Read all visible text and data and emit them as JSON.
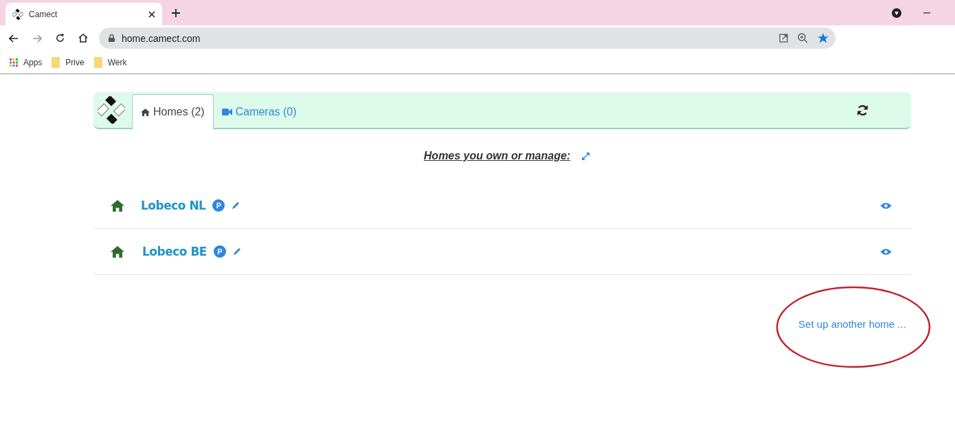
{
  "browser": {
    "tab_title": "Camect",
    "url": "home.camect.com",
    "bookmarks": [
      {
        "label": "Apps",
        "kind": "apps"
      },
      {
        "label": "Prive",
        "kind": "folder"
      },
      {
        "label": "Werk",
        "kind": "folder"
      }
    ]
  },
  "tabs": [
    {
      "label": "Homes (2)",
      "kind": "home",
      "selected": true
    },
    {
      "label": "Cameras (0)",
      "kind": "camera",
      "selected": false
    }
  ],
  "heading": "Homes you own or manage:",
  "homes": [
    {
      "name": "Lobeco NL",
      "badge": "P"
    },
    {
      "name": "Lobeco BE",
      "badge": "P"
    }
  ],
  "setup_link": "Set up another home ..."
}
